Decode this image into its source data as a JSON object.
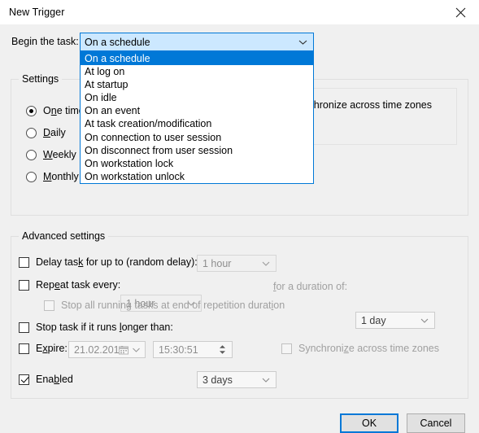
{
  "window": {
    "title": "New Trigger",
    "close_icon": "close-icon"
  },
  "begin_task": {
    "label_pre": "Begin the task:",
    "label_parts": {
      "a": "Be",
      "accel": "g",
      "b": "in the task:"
    },
    "selected_value": "On a schedule",
    "arrow_icon": "chevron-down-icon",
    "options": [
      "On a schedule",
      "At log on",
      "At startup",
      "On idle",
      "On an event",
      "At task creation/modification",
      "On connection to user session",
      "On disconnect from user session",
      "On workstation lock",
      "On workstation unlock"
    ],
    "selected_index": 0
  },
  "settings": {
    "title": "Settings",
    "radios": [
      {
        "label_a": "O",
        "accel": "n",
        "label_b": "e time",
        "text": "One time",
        "checked": true
      },
      {
        "label_a": "",
        "accel": "D",
        "label_b": "aily",
        "text": "Daily",
        "checked": false
      },
      {
        "label_a": "",
        "accel": "W",
        "label_b": "eekly",
        "text": "Weekly",
        "checked": false
      },
      {
        "label_a": "",
        "accel": "M",
        "label_b": "onthly",
        "text": "Monthly",
        "checked": false
      }
    ],
    "sync_checkbox": {
      "text_a": "S",
      "accel": "ynchroni",
      "text_b": "ze across time zones",
      "full": "Synchronize across time zones",
      "checked": false,
      "disabled": false
    }
  },
  "advanced": {
    "title": "Advanced settings",
    "delay": {
      "label_a": "Delay tas",
      "accel": "k",
      "label_b": " for up to (random delay):",
      "full": "Delay task for up to (random delay):",
      "checked": false,
      "value": "1 hour",
      "combo_disabled": true
    },
    "repeat": {
      "label_a": "Rep",
      "accel": "e",
      "label_b": "at task every:",
      "full": "Repeat task every:",
      "checked": false,
      "value": "1 hour",
      "combo_disabled": true,
      "duration_label_a": "",
      "duration_accel": "f",
      "duration_label_b": "or a duration of:",
      "duration_full": "for a duration of:",
      "duration_value": "1 day",
      "duration_disabled": false
    },
    "stop_all": {
      "full": "Stop all running tasks at end of repetition duration",
      "text_a": "Stop all running tasks at end of repetition durat",
      "accel": "i",
      "text_b": "on",
      "checked": false,
      "disabled": true
    },
    "stop_longer": {
      "text_a": "Stop task if it runs ",
      "accel": "l",
      "text_b": "onger than:",
      "full": "Stop task if it runs longer than:",
      "checked": false,
      "value": "3 days",
      "combo_disabled": false
    },
    "expire": {
      "text_a": "E",
      "accel": "x",
      "text_b": "pire:",
      "full": "Expire:",
      "checked": false,
      "date_value": "21.02.2019",
      "time_value": "15:30:51",
      "calendar_icon": "calendar-icon",
      "spinner_icon": "spinner-updown-icon",
      "sync": {
        "text_a": "Synchroni",
        "accel": "z",
        "text_b": "e across time zones",
        "full": "Synchronize across time zones",
        "checked": false,
        "disabled": true
      }
    },
    "enabled": {
      "text_a": "Ena",
      "accel": "b",
      "text_b": "led",
      "full": "Enabled",
      "checked": true
    }
  },
  "footer": {
    "ok_label": "OK",
    "cancel_label": "Cancel"
  },
  "colors": {
    "accent": "#0078d7",
    "combo_open_bg": "#cce8ff",
    "dialog_bg": "#f0f0f0"
  }
}
